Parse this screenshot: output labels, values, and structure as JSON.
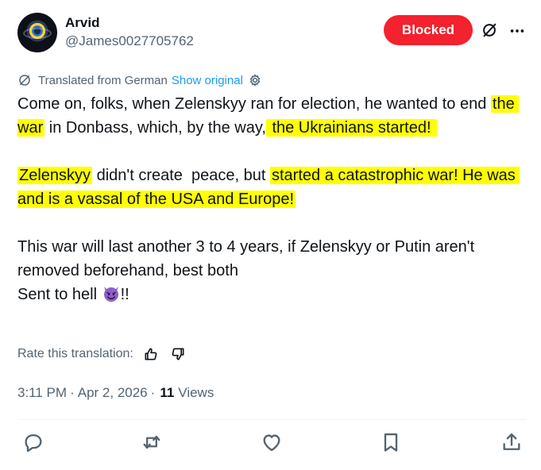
{
  "author": {
    "display_name": "Arvid",
    "handle": "@James0027705762",
    "avatar_icon": "avatar-eye-image"
  },
  "header": {
    "blocked_label": "Blocked",
    "blocked_color": "#f4212e",
    "grok_icon": "slashed-circle-icon",
    "more_icon": "more-dots-icon"
  },
  "translation": {
    "label": "Translated from German",
    "show_original": "Show original",
    "link_color": "#1d9bf0"
  },
  "tweet": {
    "highlight_color": "#ffff00",
    "p1": {
      "a": "Come on, folks, when Zelenskyy ran for election, he wanted to end ",
      "h1": "the war",
      "b": " in Donbass, which, by the way,",
      "h2": " the Ukrainians started! "
    },
    "p2": {
      "h1": "Zelenskyy",
      "a": " didn't create  peace, but ",
      "h2": "started a catastrophic war! He was and is a vassal of the USA and Europe!"
    },
    "p3": {
      "a": "This war will last another 3 to 4 years, if Zelenskyy or Putin aren't removed beforehand, best both",
      "b": "Sent to hell ",
      "emoji": "smiling-devil-emoji",
      "c": "!!"
    }
  },
  "rating": {
    "label": "Rate this translation:"
  },
  "meta": {
    "time": "3:11 PM",
    "sep1": "·",
    "date": "Apr 2, 2026",
    "sep2": "·",
    "views_count": "11",
    "views_label": "Views"
  },
  "actions": [
    "reply-icon",
    "repost-icon",
    "like-icon",
    "bookmark-icon",
    "share-icon"
  ]
}
